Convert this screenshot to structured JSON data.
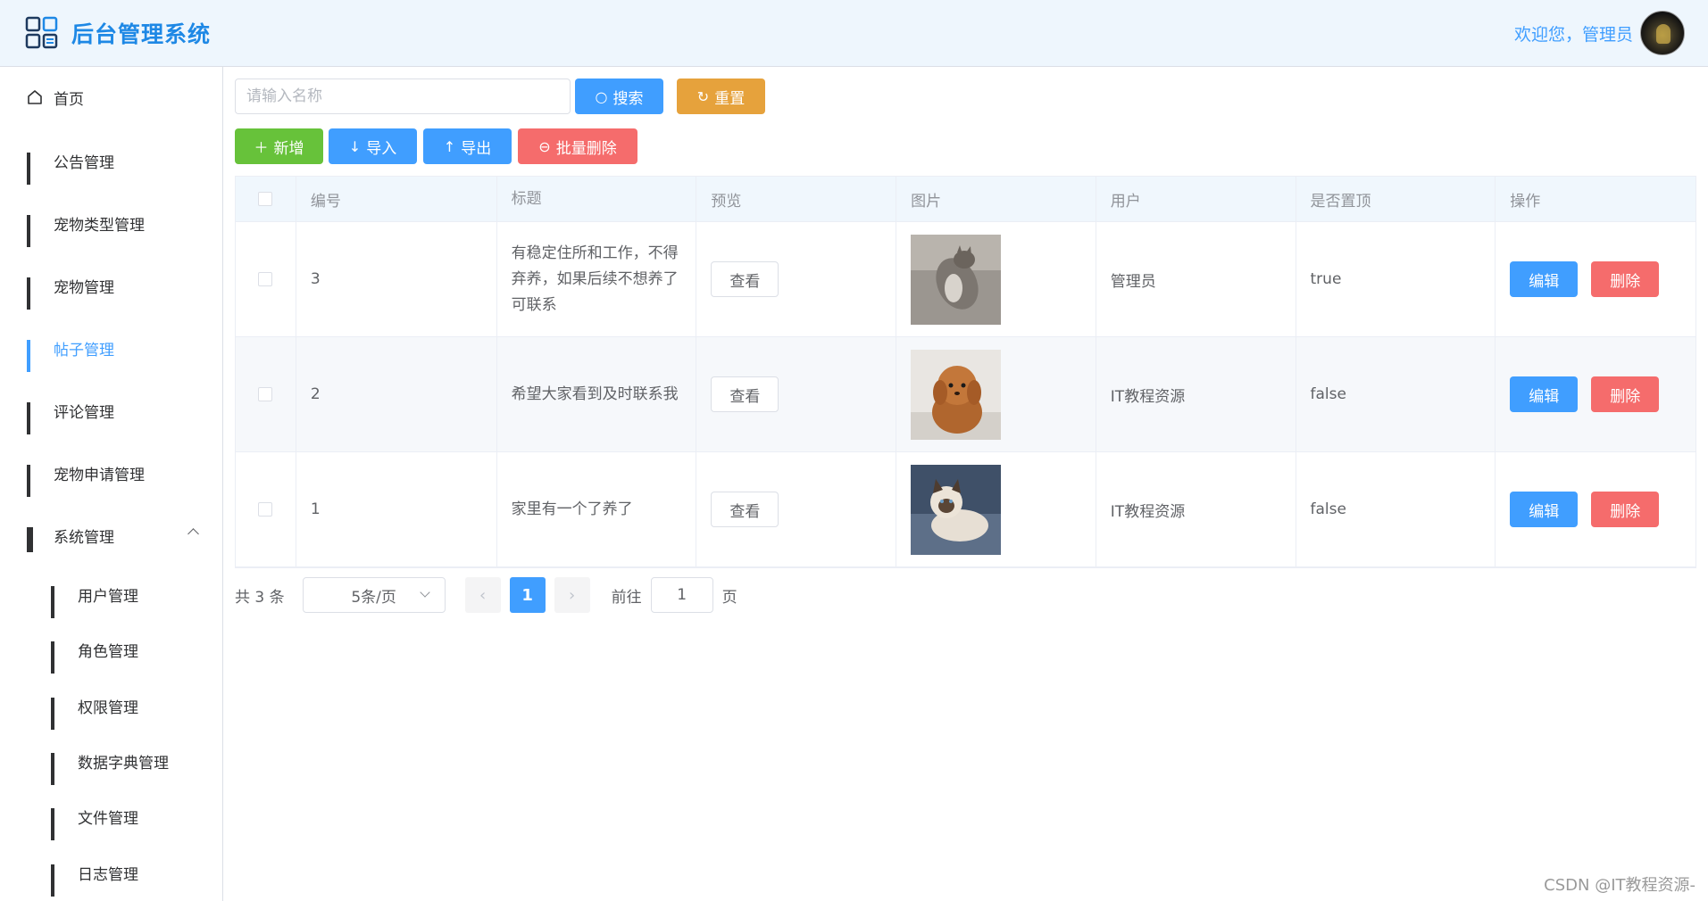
{
  "header": {
    "title": "后台管理系统",
    "welcome": "欢迎您，管理员"
  },
  "sidebar": {
    "items": [
      {
        "label": "首页",
        "icon": "home-icon"
      },
      {
        "label": "公告管理",
        "icon": "grid-icon"
      },
      {
        "label": "宠物类型管理",
        "icon": "grid-icon"
      },
      {
        "label": "宠物管理",
        "icon": "grid-icon"
      },
      {
        "label": "帖子管理",
        "icon": "grid-icon",
        "active": true
      },
      {
        "label": "评论管理",
        "icon": "grid-icon"
      },
      {
        "label": "宠物申请管理",
        "icon": "grid-icon"
      },
      {
        "label": "系统管理",
        "icon": "apps-icon",
        "expanded": true
      }
    ],
    "subitems": [
      {
        "label": "用户管理"
      },
      {
        "label": "角色管理"
      },
      {
        "label": "权限管理"
      },
      {
        "label": "数据字典管理"
      },
      {
        "label": "文件管理"
      },
      {
        "label": "日志管理"
      }
    ]
  },
  "toolbar": {
    "search_placeholder": "请输入名称",
    "search_label": "搜索",
    "reset_label": "重置",
    "add_label": "新增",
    "import_label": "导入",
    "export_label": "导出",
    "batch_delete_label": "批量删除"
  },
  "table": {
    "columns": [
      "编号",
      "标题",
      "预览",
      "图片",
      "用户",
      "是否置顶",
      "操作"
    ],
    "rows": [
      {
        "id": "3",
        "title": "有稳定住所和工作，不得弃养，如果后续不想养了可联系",
        "preview": "查看",
        "image": "tabby-cat-photo",
        "user": "管理员",
        "top": "true",
        "edit": "编辑",
        "delete": "删除"
      },
      {
        "id": "2",
        "title": "希望大家看到及时联系我",
        "preview": "查看",
        "image": "poodle-puppy-photo",
        "user": "IT教程资源",
        "top": "false",
        "edit": "编辑",
        "delete": "删除"
      },
      {
        "id": "1",
        "title": "家里有一个了养了",
        "preview": "查看",
        "image": "siamese-cat-photo",
        "user": "IT教程资源",
        "top": "false",
        "edit": "编辑",
        "delete": "删除"
      }
    ]
  },
  "pagination": {
    "total": "共 3 条",
    "page_size": "5条/页",
    "current_page": "1",
    "goto_label": "前往",
    "goto_value": "1",
    "page_suffix": "页"
  },
  "watermark": "CSDN @IT教程资源-",
  "colors": {
    "primary": "#409eff",
    "success": "#67c23a",
    "warning": "#e6a23c",
    "danger": "#f56c6c",
    "header_bg": "#eef6fd"
  }
}
